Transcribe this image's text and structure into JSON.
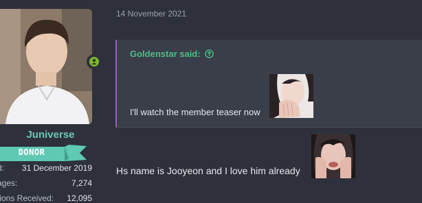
{
  "post": {
    "date": "14 November 2021",
    "quote": {
      "author": "Goldenstar said:",
      "text": "I'll watch the member teaser now"
    },
    "body_text": "Hs name is Jooyeon and I love him already"
  },
  "user": {
    "name": "Juniverse",
    "banner": "DONOR",
    "stats": [
      {
        "label": "d:",
        "value": "31 December 2019"
      },
      {
        "label": "ages:",
        "value": "7,274"
      },
      {
        "label": "tions Received:",
        "value": "12,095"
      }
    ],
    "online_icon": "user-online-icon"
  },
  "colors": {
    "background": "#2e313b",
    "username": "#6cc7b1",
    "quote_author": "#46c08a",
    "quote_border": "#9b5fc4",
    "banner": "#5fc9b4"
  }
}
